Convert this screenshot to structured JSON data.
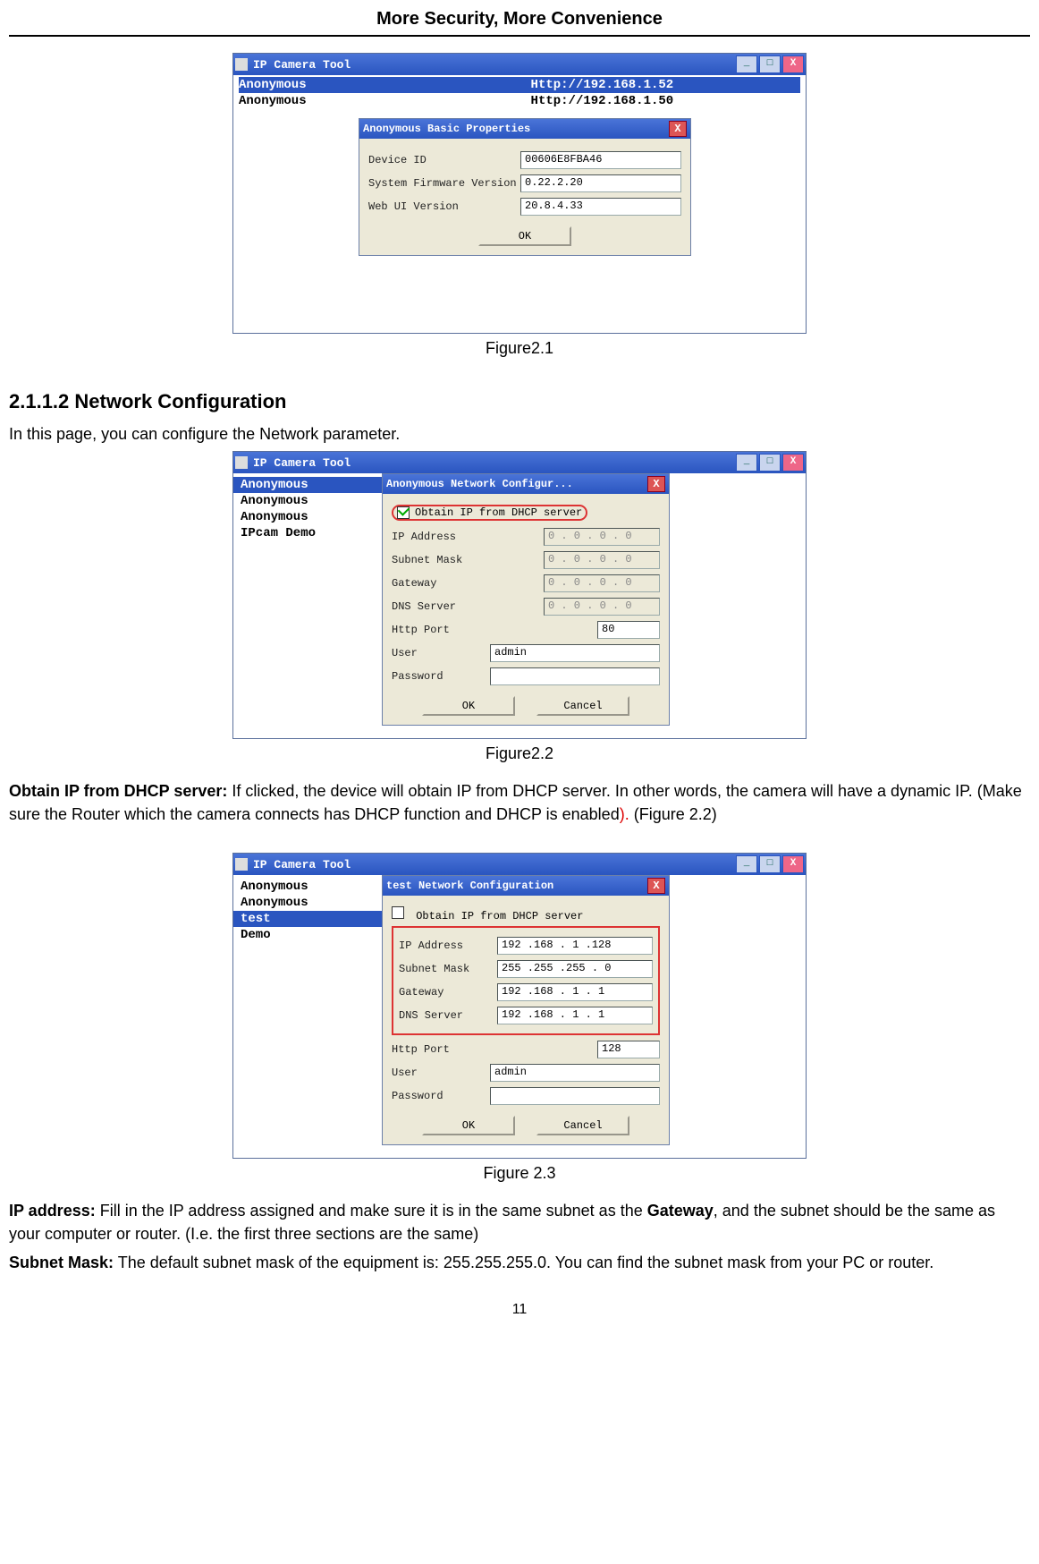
{
  "header": {
    "title": "More Security, More Convenience"
  },
  "fig1": {
    "caption": "Figure2.1",
    "toolTitle": "IP Camera Tool",
    "rows": [
      {
        "name": "Anonymous",
        "url": "Http://192.168.1.52",
        "selected": true
      },
      {
        "name": "Anonymous",
        "url": "Http://192.168.1.50",
        "selected": false
      }
    ],
    "dialog": {
      "title": "Anonymous Basic Properties",
      "fields": {
        "deviceIdLabel": "Device ID",
        "deviceId": "00606E8FBA46",
        "fwLabel": "System Firmware Version",
        "fw": "0.22.2.20",
        "webLabel": "Web UI Version",
        "web": "20.8.4.33"
      },
      "ok": "OK"
    }
  },
  "section": {
    "heading": "2.1.1.2 Network Configuration",
    "intro": "In this page, you can configure the Network parameter."
  },
  "fig2": {
    "caption": "Figure2.2",
    "toolTitle": "IP Camera Tool",
    "sideNames": [
      "Anonymous",
      "Anonymous",
      "Anonymous",
      "IPcam Demo"
    ],
    "selectedIndex": 0,
    "dialog": {
      "title": "Anonymous Network Configur...",
      "dhcpLabel": "Obtain IP from DHCP server",
      "dhcpChecked": true,
      "ipLabel": "IP Address",
      "ip": "0 . 0 . 0 . 0",
      "maskLabel": "Subnet Mask",
      "mask": "0 . 0 . 0 . 0",
      "gwLabel": "Gateway",
      "gw": "0 . 0 . 0 . 0",
      "dnsLabel": "DNS Server",
      "dns": "0 . 0 . 0 . 0",
      "portLabel": "Http Port",
      "port": "80",
      "userLabel": "User",
      "user": "admin",
      "passLabel": "Password",
      "pass": "",
      "ok": "OK",
      "cancel": "Cancel"
    }
  },
  "para1": {
    "label": "Obtain IP from DHCP server:",
    "text": " If clicked, the device will obtain IP from DHCP server. In other words, the camera will have a dynamic IP. (Make sure the Router which the camera connects has DHCP function and DHCP is enabled",
    "tail": " (Figure 2.2)"
  },
  "fig3": {
    "caption": "Figure 2.3",
    "toolTitle": "IP Camera Tool",
    "sideNames": [
      "Anonymous",
      "Anonymous",
      "test",
      "Demo"
    ],
    "selectedIndex": 2,
    "dialog": {
      "title": "test Network Configuration",
      "dhcpLabel": "Obtain IP from DHCP server",
      "dhcpChecked": false,
      "ipLabel": "IP Address",
      "ip": "192 .168 . 1  .128",
      "maskLabel": "Subnet Mask",
      "mask": "255 .255 .255 . 0",
      "gwLabel": "Gateway",
      "gw": "192 .168 . 1  . 1",
      "dnsLabel": "DNS Server",
      "dns": "192 .168 . 1  . 1",
      "portLabel": "Http Port",
      "port": "128",
      "userLabel": "User",
      "user": "admin",
      "passLabel": "Password",
      "pass": "",
      "ok": "OK",
      "cancel": "Cancel"
    }
  },
  "para2": {
    "ipLabel": "IP address:",
    "ipText": " Fill in the IP address assigned and make sure it is in the same subnet as the ",
    "gatewayWord": "Gateway",
    "ipTail": ", and the subnet should be the same as your computer or router. (I.e. the first three sections are the same)",
    "maskLabel": "Subnet Mask:",
    "maskText": " The default subnet mask of the equipment is: 255.255.255.0. You can find the subnet mask from your PC or router."
  },
  "pageNumber": "11",
  "ui": {
    "minimize": "_",
    "maximize": "□",
    "close": "X"
  }
}
